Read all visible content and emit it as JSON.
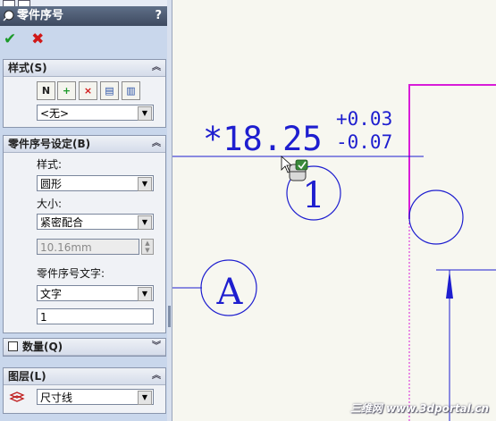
{
  "property_manager": {
    "title": "零件序号",
    "help_label": "?",
    "ok_label": "✔",
    "cancel_label": "✖"
  },
  "style_group": {
    "header": "样式(S)",
    "buttons": [
      "N",
      "+",
      "×",
      "▤",
      "▥"
    ],
    "style_value": "<无>"
  },
  "balloon_settings": {
    "header": "零件序号设定(B)",
    "style_label": "样式:",
    "style_value": "圆形",
    "size_label": "大小:",
    "size_value": "紧密配合",
    "size_custom_value": "10.16mm",
    "text_label": "零件序号文字:",
    "text_value": "文字",
    "text_input_value": "1"
  },
  "quantity_group": {
    "header": "数量(Q)"
  },
  "layer_group": {
    "header": "图层(L)",
    "layer_value": "尺寸线"
  },
  "drawing": {
    "dimension_value": "*18.25",
    "tol_upper": "+0.03",
    "tol_lower": "-0.07",
    "balloon_1_text": "1",
    "balloon_a_text": "A"
  },
  "watermark": "三维网 www.3dportal.cn",
  "colors": {
    "annotation_blue": "#1e1ecf",
    "sheet_magenta": "#d81cd8"
  }
}
